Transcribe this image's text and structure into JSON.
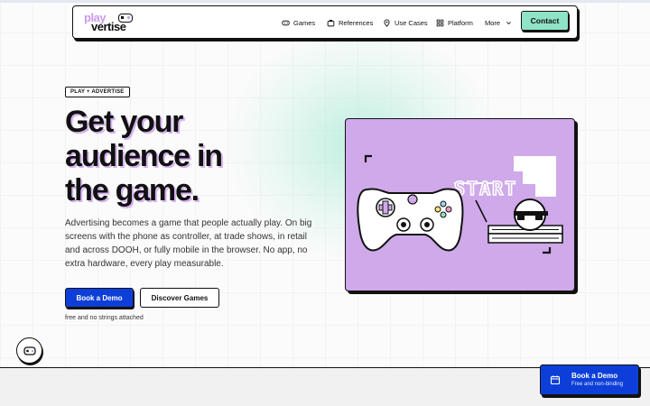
{
  "nav": {
    "logo_top": "play",
    "logo_bottom": "vertise",
    "items": [
      {
        "label": "Games",
        "icon": "gamepad-icon"
      },
      {
        "label": "References",
        "icon": "briefcase-icon"
      },
      {
        "label": "Use Cases",
        "icon": "location-pin-icon"
      },
      {
        "label": "Platform",
        "icon": "grid-icon"
      },
      {
        "label": "More",
        "icon": "chevron-down-icon"
      }
    ],
    "contact_label": "Contact"
  },
  "hero": {
    "badge": "PLAY + ADVERTISE",
    "headline_lines": [
      "Get your",
      "audience in",
      "the game."
    ],
    "description": "Advertising becomes a game that people actually play. On big screens with the phone as controller, at trade shows, in retail and across DOOH, or fully mobile in the browser. No app, no extra hardware, every play measurable.",
    "primary_cta": "Book a Demo",
    "secondary_cta": "Discover Games",
    "note": "free and no strings attached"
  },
  "illustration": {
    "text": "START"
  },
  "sticky_cta": {
    "title": "Book a Demo",
    "subtitle": "Free and non-binding"
  },
  "colors": {
    "accent_purple": "#cfa9ea",
    "accent_mint": "#8fe3c6",
    "primary_blue": "#0d3fd8"
  }
}
